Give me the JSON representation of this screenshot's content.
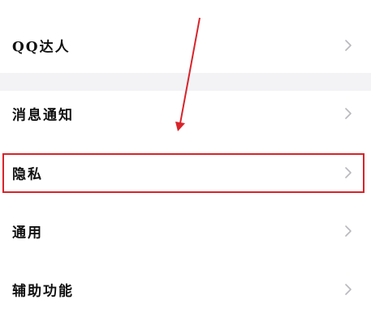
{
  "settings": {
    "items": [
      {
        "label": "QQ达人",
        "icon": "chevron-right-icon"
      },
      {
        "label": "消息通知",
        "icon": "chevron-right-icon"
      },
      {
        "label": "隐私",
        "icon": "chevron-right-icon"
      },
      {
        "label": "通用",
        "icon": "chevron-right-icon"
      },
      {
        "label": "辅助功能",
        "icon": "chevron-right-icon"
      }
    ]
  },
  "annotation": {
    "highlighted_item": "隐私",
    "color": "#d8232a"
  },
  "colors": {
    "section_gap": "#f3f3f6",
    "chevron": "#b8b8bd",
    "text": "#111111"
  }
}
